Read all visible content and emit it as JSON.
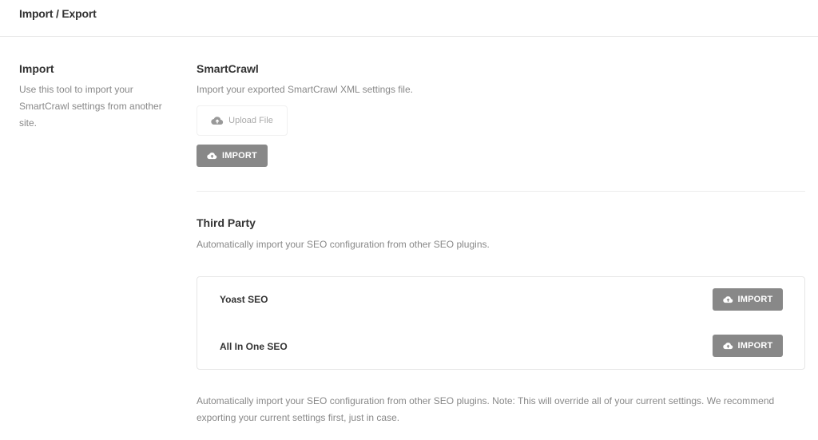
{
  "header": {
    "title": "Import / Export"
  },
  "sidebar": {
    "title": "Import",
    "description": "Use this tool to import your SmartCrawl settings from another site."
  },
  "smartcrawl": {
    "title": "SmartCrawl",
    "description": "Import your exported SmartCrawl XML settings file.",
    "upload_label": "Upload File",
    "import_label": "IMPORT"
  },
  "third_party": {
    "title": "Third Party",
    "description": "Automatically import your SEO configuration from other SEO plugins.",
    "plugins": [
      {
        "name": "Yoast SEO",
        "import_label": "IMPORT"
      },
      {
        "name": "All In One SEO",
        "import_label": "IMPORT"
      }
    ],
    "note": "Automatically import your SEO configuration from other SEO plugins. Note: This will override all of your current settings. We recommend exporting your current settings first, just in case."
  },
  "colors": {
    "button_bg": "#888888",
    "text_primary": "#333333",
    "text_muted": "#888888"
  },
  "icons": {
    "upload": "cloud-upload-icon"
  }
}
